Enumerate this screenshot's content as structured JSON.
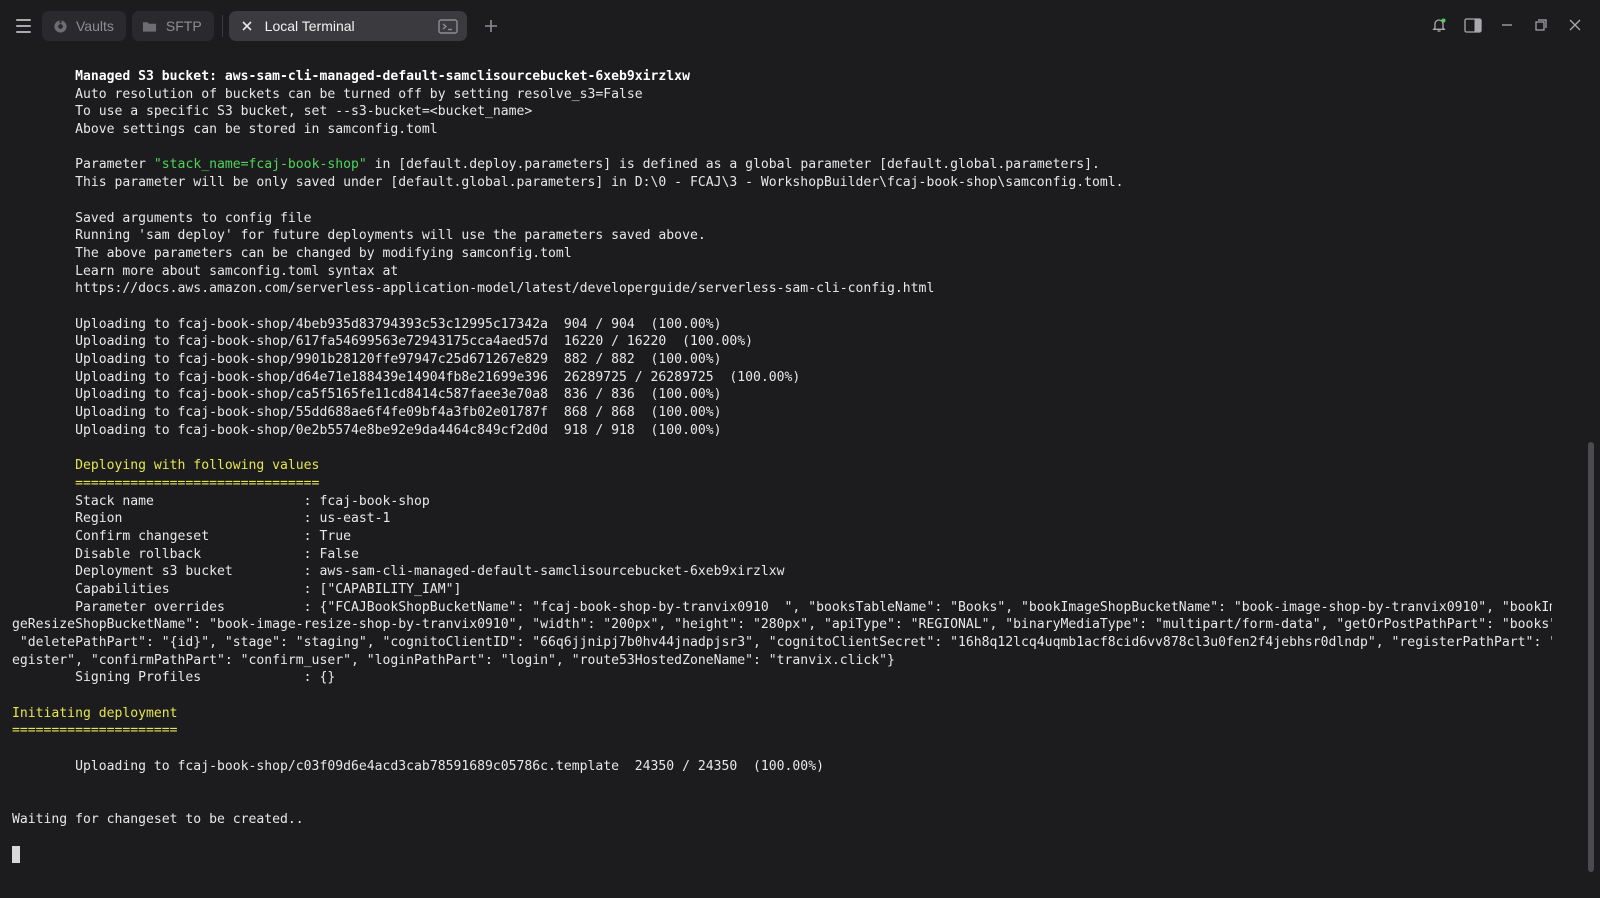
{
  "tabs": {
    "vaults": "Vaults",
    "sftp": "SFTP",
    "active": "Local Terminal"
  },
  "terminal": {
    "lines": [
      {
        "t": "        Managed S3 bucket: aws-sam-cli-managed-default-samclisourcebucket-6xeb9xirzlxw",
        "c": "b"
      },
      {
        "t": "        Auto resolution of buckets can be turned off by setting resolve_s3=False"
      },
      {
        "t": "        To use a specific S3 bucket, set --s3-bucket=<bucket_name>"
      },
      {
        "t": "        Above settings can be stored in samconfig.toml"
      },
      {
        "t": ""
      },
      {
        "t": "        Parameter ",
        "g": "\"stack_name=fcaj-book-shop\"",
        "r": " in [default.deploy.parameters] is defined as a global parameter [default.global.parameters]."
      },
      {
        "t": "        This parameter will be only saved under [default.global.parameters] in D:\\0 - FCAJ\\3 - WorkshopBuilder\\fcaj-book-shop\\samconfig.toml."
      },
      {
        "t": ""
      },
      {
        "t": "        Saved arguments to config file"
      },
      {
        "t": "        Running 'sam deploy' for future deployments will use the parameters saved above."
      },
      {
        "t": "        The above parameters can be changed by modifying samconfig.toml"
      },
      {
        "t": "        Learn more about samconfig.toml syntax at"
      },
      {
        "t": "        https://docs.aws.amazon.com/serverless-application-model/latest/developerguide/serverless-sam-cli-config.html"
      },
      {
        "t": ""
      },
      {
        "t": "        Uploading to fcaj-book-shop/4beb935d83794393c53c12995c17342a  904 / 904  (100.00%)"
      },
      {
        "t": "        Uploading to fcaj-book-shop/617fa54699563e72943175cca4aed57d  16220 / 16220  (100.00%)"
      },
      {
        "t": "        Uploading to fcaj-book-shop/9901b28120ffe97947c25d671267e829  882 / 882  (100.00%)"
      },
      {
        "t": "        Uploading to fcaj-book-shop/d64e71e188439e14904fb8e21699e396  26289725 / 26289725  (100.00%)"
      },
      {
        "t": "        Uploading to fcaj-book-shop/ca5f5165fe11cd8414c587faee3e70a8  836 / 836  (100.00%)"
      },
      {
        "t": "        Uploading to fcaj-book-shop/55dd688ae6f4fe09bf4a3fb02e01787f  868 / 868  (100.00%)"
      },
      {
        "t": "        Uploading to fcaj-book-shop/0e2b5574e8be92e9da4464c849cf2d0d  918 / 918  (100.00%)"
      },
      {
        "t": ""
      },
      {
        "t": "        Deploying with following values",
        "c": "y"
      },
      {
        "t": "        ===============================",
        "c": "y"
      },
      {
        "t": "        Stack name                   : fcaj-book-shop"
      },
      {
        "t": "        Region                       : us-east-1"
      },
      {
        "t": "        Confirm changeset            : True"
      },
      {
        "t": "        Disable rollback             : False"
      },
      {
        "t": "        Deployment s3 bucket         : aws-sam-cli-managed-default-samclisourcebucket-6xeb9xirzlxw"
      },
      {
        "t": "        Capabilities                 : [\"CAPABILITY_IAM\"]"
      },
      {
        "t": "        Parameter overrides          : {\"FCAJBookShopBucketName\": \"fcaj-book-shop-by-tranvix0910  \", \"booksTableName\": \"Books\", \"bookImageShopBucketName\": \"book-image-shop-by-tranvix0910\", \"bookIma"
      },
      {
        "t": "geResizeShopBucketName\": \"book-image-resize-shop-by-tranvix0910\", \"width\": \"200px\", \"height\": \"280px\", \"apiType\": \"REGIONAL\", \"binaryMediaType\": \"multipart/form-data\", \"getOrPostPathPart\": \"books\","
      },
      {
        "t": " \"deletePathPart\": \"{id}\", \"stage\": \"staging\", \"cognitoClientID\": \"66q6jjnipj7b0hv44jnadpjsr3\", \"cognitoClientSecret\": \"16h8q12lcq4uqmb1acf8cid6vv878cl3u0fen2f4jebhsr0dlndp\", \"registerPathPart\": \"r"
      },
      {
        "t": "egister\", \"confirmPathPart\": \"confirm_user\", \"loginPathPart\": \"login\", \"route53HostedZoneName\": \"tranvix.click\"}"
      },
      {
        "t": "        Signing Profiles             : {}"
      },
      {
        "t": ""
      },
      {
        "t": "Initiating deployment",
        "c": "y"
      },
      {
        "t": "=====================",
        "c": "y"
      },
      {
        "t": ""
      },
      {
        "t": "        Uploading to fcaj-book-shop/c03f09d6e4acd3cab78591689c05786c.template  24350 / 24350  (100.00%)"
      },
      {
        "t": ""
      },
      {
        "t": ""
      },
      {
        "t": "Waiting for changeset to be created.."
      },
      {
        "t": ""
      },
      {
        "t": "",
        "cursor": true
      }
    ]
  }
}
